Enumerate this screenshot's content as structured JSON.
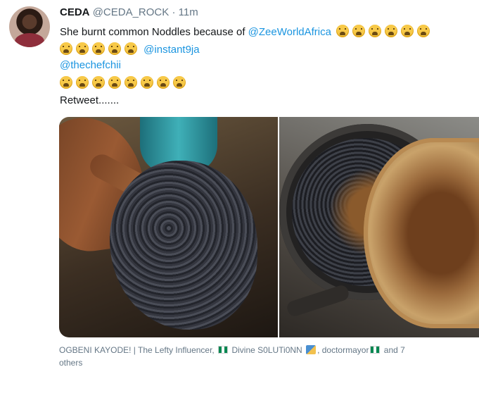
{
  "tweet": {
    "display_name": "CEDA",
    "handle": "@CEDA_ROCK",
    "separator": "·",
    "time": "11m",
    "text_line1": "She burnt common Noddles because of ",
    "mention_zee": "@ZeeWorldAfrica",
    "mention_instant": "@instant9ja",
    "mention_chef": "@thechefchii",
    "retweet_text": "Retweet.......",
    "emoji_name": "weary-face-emoji"
  },
  "liked_by": {
    "part1": "OGBENI KAYODE! | The Lefty Influencer,",
    "part2": "Divine S0LUTi0NN",
    "part3": ", doctormayor",
    "part4": "and 7",
    "part5": "others",
    "flag_name": "nigeria-flag-icon"
  },
  "media": {
    "photo_left": "burnt noodles held in hand",
    "photo_right": "burnt noodles in pot with lid"
  }
}
